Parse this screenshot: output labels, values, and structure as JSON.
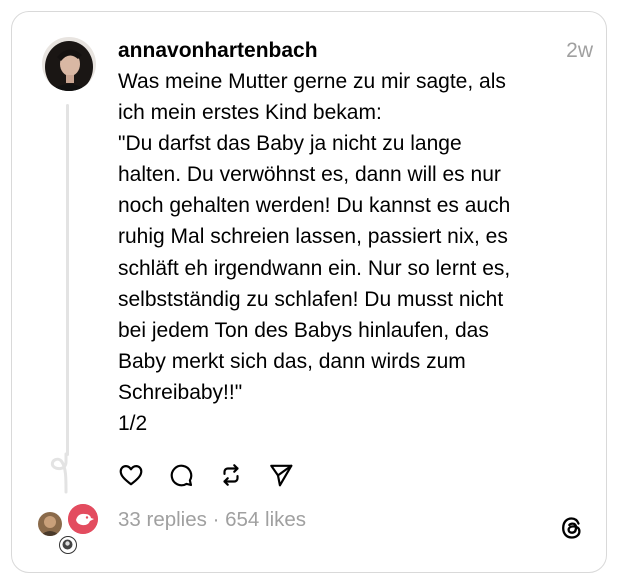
{
  "post": {
    "username": "annavonhartenbach",
    "timestamp": "2w",
    "text_lines": [
      "Was meine Mutter gerne zu mir sagte, als",
      "ich mein erstes Kind bekam:",
      "\"Du darfst das Baby ja nicht zu lange",
      "halten. Du verwöhnst es, dann will es nur",
      "noch gehalten werden! Du kannst es auch",
      "ruhig Mal schreien lassen, passiert nix, es",
      "schläft eh irgendwann ein. Nur so lernt es,",
      "selbstständig zu schlafen! Du musst nicht",
      "bei jedem Ton des Babys hinlaufen, das",
      "Baby merkt sich das, dann wirds zum",
      "Schreibaby!!\"",
      "1/2"
    ]
  },
  "actions": [
    {
      "name": "like",
      "icon": "heart-icon"
    },
    {
      "name": "reply",
      "icon": "comment-bubble-icon"
    },
    {
      "name": "repost",
      "icon": "repost-arrows-icon"
    },
    {
      "name": "share",
      "icon": "send-paper-plane-icon"
    }
  ],
  "stats": {
    "replies": "33 replies",
    "separator": " · ",
    "likes": "654 likes"
  },
  "brand": {
    "logo_icon": "threads-logo-icon"
  },
  "colors": {
    "text": "#000000",
    "muted": "#a0a0a0",
    "border": "#d9d9d9",
    "thread_line": "#e3e3e3",
    "reply_avatar_accent": "#e34c5f"
  }
}
